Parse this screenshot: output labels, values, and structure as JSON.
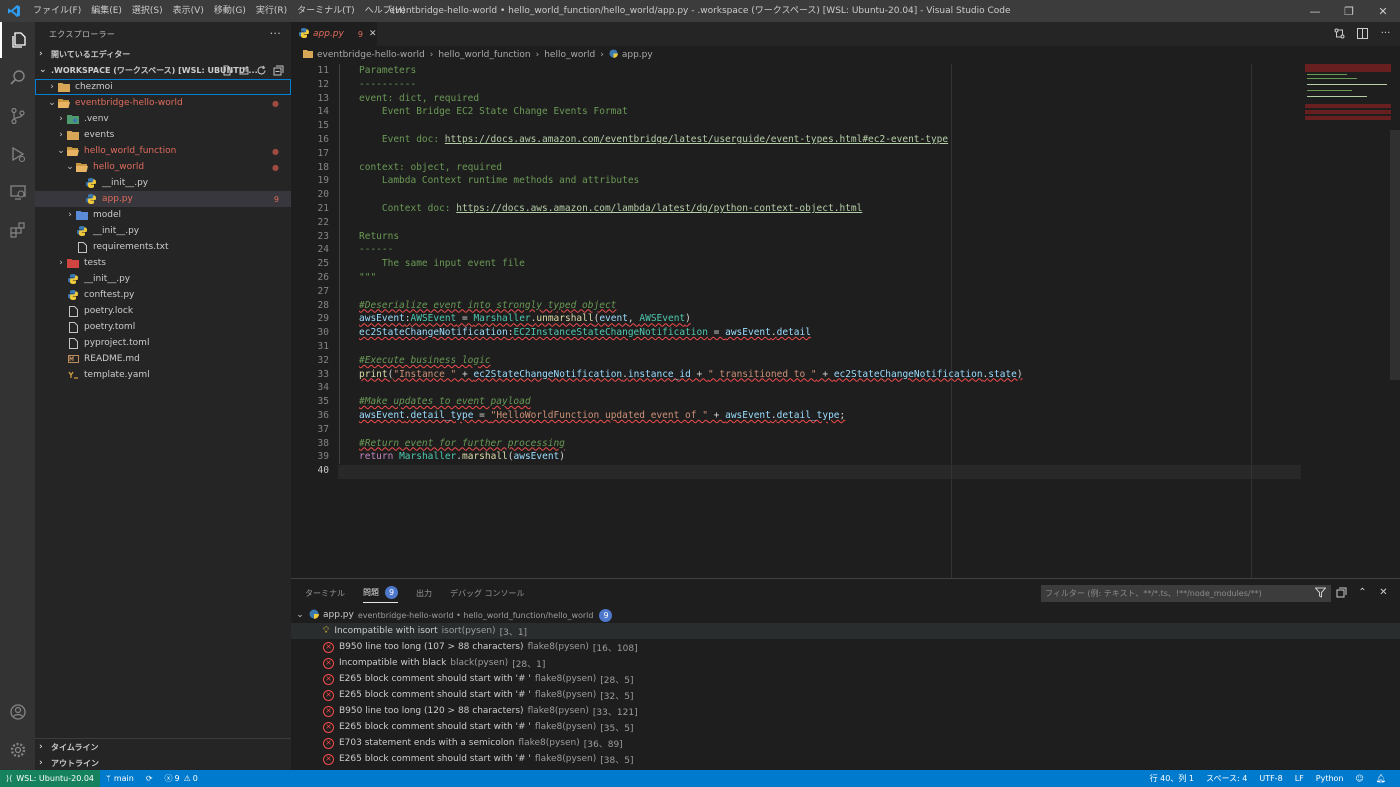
{
  "titlebar": {
    "menus": [
      "ファイル(F)",
      "編集(E)",
      "選択(S)",
      "表示(V)",
      "移動(G)",
      "実行(R)",
      "ターミナル(T)",
      "ヘルプ(H)"
    ],
    "title": "eventbridge-hello-world • hello_world_function/hello_world/app.py - .workspace (ワークスペース) [WSL: Ubuntu-20.04] - Visual Studio Code"
  },
  "sidebar": {
    "header": "エクスプローラー",
    "open_editors": "開いているエディター",
    "workspace": ".WORKSPACE (ワークスペース) [WSL: UBUNTU-...",
    "tree": [
      {
        "label": "chezmoi",
        "indent": 0,
        "chev": "›",
        "icon": "folder",
        "color": "#cccccc",
        "badge": ""
      },
      {
        "label": "eventbridge-hello-world",
        "indent": 0,
        "chev": "⌄",
        "icon": "folder-open",
        "color": "#e06c5c",
        "badge": "●"
      },
      {
        "label": ".venv",
        "indent": 1,
        "chev": "›",
        "icon": "folder-venv",
        "color": "#cccccc",
        "badge": ""
      },
      {
        "label": "events",
        "indent": 1,
        "chev": "›",
        "icon": "folder",
        "color": "#cccccc",
        "badge": ""
      },
      {
        "label": "hello_world_function",
        "indent": 1,
        "chev": "⌄",
        "icon": "folder-open",
        "color": "#e06c5c",
        "badge": "●"
      },
      {
        "label": "hello_world",
        "indent": 2,
        "chev": "⌄",
        "icon": "folder-open",
        "color": "#e06c5c",
        "badge": "●"
      },
      {
        "label": "__init__.py",
        "indent": 3,
        "chev": "",
        "icon": "python",
        "color": "#cccccc",
        "badge": ""
      },
      {
        "label": "app.py",
        "indent": 3,
        "chev": "",
        "icon": "python",
        "color": "#e06c5c",
        "badge": "9"
      },
      {
        "label": "model",
        "indent": 2,
        "chev": "›",
        "icon": "folder-model",
        "color": "#cccccc",
        "badge": ""
      },
      {
        "label": "__init__.py",
        "indent": 2,
        "chev": "",
        "icon": "python",
        "color": "#cccccc",
        "badge": ""
      },
      {
        "label": "requirements.txt",
        "indent": 2,
        "chev": "",
        "icon": "file",
        "color": "#cccccc",
        "badge": ""
      },
      {
        "label": "tests",
        "indent": 1,
        "chev": "›",
        "icon": "folder-test",
        "color": "#cccccc",
        "badge": ""
      },
      {
        "label": "__init__.py",
        "indent": 1,
        "chev": "",
        "icon": "python",
        "color": "#cccccc",
        "badge": ""
      },
      {
        "label": "conftest.py",
        "indent": 1,
        "chev": "",
        "icon": "python",
        "color": "#cccccc",
        "badge": ""
      },
      {
        "label": "poetry.lock",
        "indent": 1,
        "chev": "",
        "icon": "file",
        "color": "#cccccc",
        "badge": ""
      },
      {
        "label": "poetry.toml",
        "indent": 1,
        "chev": "",
        "icon": "file",
        "color": "#cccccc",
        "badge": ""
      },
      {
        "label": "pyproject.toml",
        "indent": 1,
        "chev": "",
        "icon": "file",
        "color": "#cccccc",
        "badge": ""
      },
      {
        "label": "README.md",
        "indent": 1,
        "chev": "",
        "icon": "markdown",
        "color": "#cccccc",
        "badge": ""
      },
      {
        "label": "template.yaml",
        "indent": 1,
        "chev": "",
        "icon": "yaml",
        "color": "#cccccc",
        "badge": ""
      }
    ],
    "timeline": "タイムライン",
    "outline": "アウトライン"
  },
  "tab": {
    "name": "app.py",
    "count": "9"
  },
  "breadcrumb": [
    "eventbridge-hello-world",
    "hello_world_function",
    "hello_world",
    "app.py"
  ],
  "code": {
    "current_line": "40",
    "lines": [
      {
        "n": "11",
        "segs": [
          [
            "doc",
            "Parameters"
          ]
        ]
      },
      {
        "n": "12",
        "segs": [
          [
            "doc",
            "----------"
          ]
        ]
      },
      {
        "n": "13",
        "segs": [
          [
            "doc",
            "event: dict, required"
          ]
        ]
      },
      {
        "n": "14",
        "segs": [
          [
            "doc",
            "    Event Bridge EC2 State Change Events Format"
          ]
        ]
      },
      {
        "n": "15",
        "segs": []
      },
      {
        "n": "16",
        "segs": [
          [
            "doc",
            "    Event doc: "
          ],
          [
            "link",
            "https://docs.aws.amazon.com/eventbridge/latest/userguide/event-types.html#ec2-event-type"
          ]
        ]
      },
      {
        "n": "17",
        "segs": []
      },
      {
        "n": "18",
        "segs": [
          [
            "doc",
            "context: object, required"
          ]
        ]
      },
      {
        "n": "19",
        "segs": [
          [
            "doc",
            "    Lambda Context runtime methods and attributes"
          ]
        ]
      },
      {
        "n": "20",
        "segs": []
      },
      {
        "n": "21",
        "segs": [
          [
            "doc",
            "    Context doc: "
          ],
          [
            "link",
            "https://docs.aws.amazon.com/lambda/latest/dg/python-context-object.html"
          ]
        ]
      },
      {
        "n": "22",
        "segs": []
      },
      {
        "n": "23",
        "segs": [
          [
            "doc",
            "Returns"
          ]
        ]
      },
      {
        "n": "24",
        "segs": [
          [
            "doc",
            "------"
          ]
        ]
      },
      {
        "n": "25",
        "segs": [
          [
            "doc",
            "    The same input event file"
          ]
        ]
      },
      {
        "n": "26",
        "segs": [
          [
            "doc",
            "\"\"\""
          ]
        ]
      },
      {
        "n": "27",
        "segs": []
      },
      {
        "n": "28",
        "segs": [
          [
            "cmt",
            "#Deserialize event into strongly typed object"
          ]
        ]
      },
      {
        "n": "29",
        "segs": [
          [
            "var squig",
            "awsEvent"
          ],
          [
            "plain squig",
            ":"
          ],
          [
            "cls squig",
            "AWSEvent"
          ],
          [
            "plain squig",
            " = "
          ],
          [
            "cls squig",
            "Marshaller"
          ],
          [
            "plain squig",
            "."
          ],
          [
            "fn squig",
            "unmarshall"
          ],
          [
            "plain squig",
            "("
          ],
          [
            "var squig",
            "event"
          ],
          [
            "plain squig",
            ", "
          ],
          [
            "cls squig",
            "AWSEvent"
          ],
          [
            "plain squig",
            ")"
          ]
        ]
      },
      {
        "n": "30",
        "segs": [
          [
            "var squig",
            "ec2StateChangeNotification"
          ],
          [
            "plain squig",
            ":"
          ],
          [
            "cls squig",
            "EC2InstanceStateChangeNotification"
          ],
          [
            "plain squig",
            " = "
          ],
          [
            "var squig",
            "awsEvent"
          ],
          [
            "plain squig",
            "."
          ],
          [
            "var squig",
            "detail"
          ]
        ]
      },
      {
        "n": "31",
        "segs": []
      },
      {
        "n": "32",
        "segs": [
          [
            "cmt",
            "#Execute business logic"
          ]
        ]
      },
      {
        "n": "33",
        "segs": [
          [
            "fn squig",
            "print"
          ],
          [
            "plain squig",
            "("
          ],
          [
            "str squig",
            "\"Instance \""
          ],
          [
            "plain squig",
            " + "
          ],
          [
            "var squig",
            "ec2StateChangeNotification"
          ],
          [
            "plain squig",
            "."
          ],
          [
            "var squig",
            "instance_id"
          ],
          [
            "plain squig",
            " + "
          ],
          [
            "str squig",
            "\" transitioned to \""
          ],
          [
            "plain squig",
            " + "
          ],
          [
            "var squig",
            "ec2StateChangeNotification"
          ],
          [
            "plain squig",
            "."
          ],
          [
            "var squig",
            "state"
          ],
          [
            "plain squig",
            ")"
          ]
        ]
      },
      {
        "n": "34",
        "segs": []
      },
      {
        "n": "35",
        "segs": [
          [
            "cmt",
            "#Make updates to event payload"
          ]
        ]
      },
      {
        "n": "36",
        "segs": [
          [
            "var squig",
            "awsEvent"
          ],
          [
            "plain squig",
            "."
          ],
          [
            "var squig",
            "detail_type"
          ],
          [
            "plain squig",
            " = "
          ],
          [
            "str squig",
            "\"HelloWorldFunction updated event of \""
          ],
          [
            "plain squig",
            " + "
          ],
          [
            "var squig",
            "awsEvent"
          ],
          [
            "plain squig",
            "."
          ],
          [
            "var squig",
            "detail_type"
          ],
          [
            "plain squig",
            ";"
          ]
        ]
      },
      {
        "n": "37",
        "segs": []
      },
      {
        "n": "38",
        "segs": [
          [
            "cmt",
            "#Return event for further processing"
          ]
        ]
      },
      {
        "n": "39",
        "segs": [
          [
            "kw",
            "return"
          ],
          [
            "plain",
            " "
          ],
          [
            "cls",
            "Marshaller"
          ],
          [
            "plain",
            "."
          ],
          [
            "fn",
            "marshall"
          ],
          [
            "plain",
            "("
          ],
          [
            "var",
            "awsEvent"
          ],
          [
            "plain",
            ")"
          ]
        ]
      },
      {
        "n": "40",
        "segs": []
      }
    ]
  },
  "panel": {
    "tabs": [
      "ターミナル",
      "問題",
      "出力",
      "デバッグ コンソール"
    ],
    "problems_count": "9",
    "filter_placeholder": "フィルター (例: テキスト、**/*.ts、!**/node_modules/**)",
    "file": {
      "name": "app.py",
      "path": "eventbridge-hello-world • hello_world_function/hello_world",
      "count": "9"
    },
    "problems": [
      {
        "kind": "warn",
        "text": "Incompatible with isort",
        "src": "isort(pysen)",
        "pos": "[3、1]"
      },
      {
        "kind": "err",
        "text": "B950 line too long (107 > 88 characters)",
        "src": "flake8(pysen)",
        "pos": "[16、108]"
      },
      {
        "kind": "err",
        "text": "Incompatible with black",
        "src": "black(pysen)",
        "pos": "[28、1]"
      },
      {
        "kind": "err",
        "text": "E265 block comment should start with '# '",
        "src": "flake8(pysen)",
        "pos": "[28、5]"
      },
      {
        "kind": "err",
        "text": "E265 block comment should start with '# '",
        "src": "flake8(pysen)",
        "pos": "[32、5]"
      },
      {
        "kind": "err",
        "text": "B950 line too long (120 > 88 characters)",
        "src": "flake8(pysen)",
        "pos": "[33、121]"
      },
      {
        "kind": "err",
        "text": "E265 block comment should start with '# '",
        "src": "flake8(pysen)",
        "pos": "[35、5]"
      },
      {
        "kind": "err",
        "text": "E703 statement ends with a semicolon",
        "src": "flake8(pysen)",
        "pos": "[36、89]"
      },
      {
        "kind": "err",
        "text": "E265 block comment should start with '# '",
        "src": "flake8(pysen)",
        "pos": "[38、5]"
      }
    ]
  },
  "status": {
    "remote": "WSL: Ubuntu-20.04",
    "branch": "main",
    "errors": "9",
    "warnings": "0",
    "position": "行 40、列 1",
    "spaces": "スペース: 4",
    "encoding": "UTF-8",
    "eol": "LF",
    "language": "Python"
  },
  "colors": {
    "accent": "#007acc",
    "remote": "#16825d",
    "error": "#f14c4c",
    "modified": "#e06c5c"
  }
}
